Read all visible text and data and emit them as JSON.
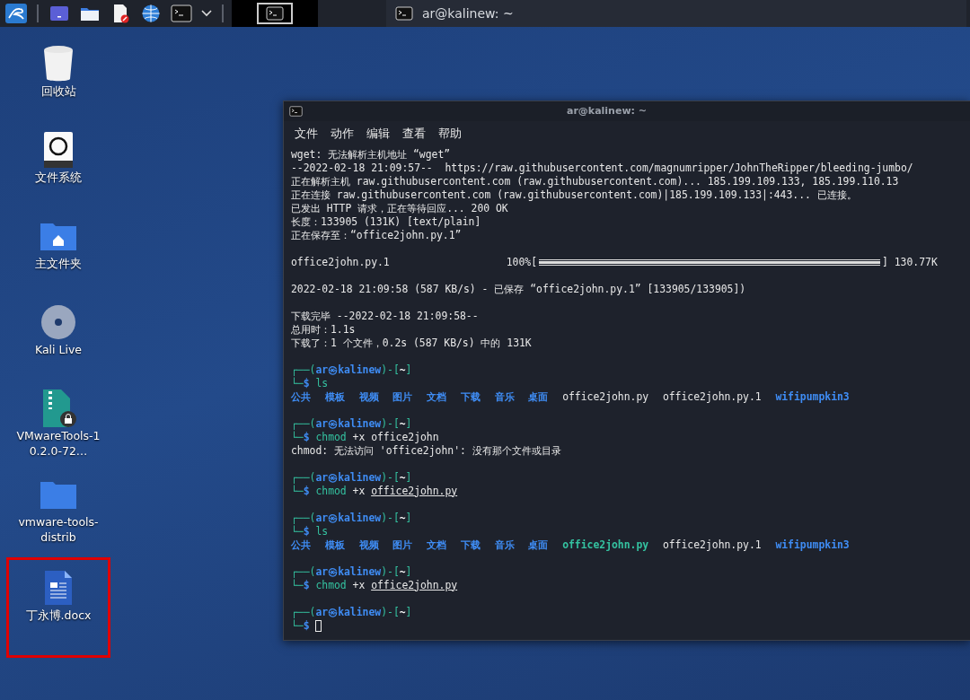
{
  "taskbar": {
    "launchers": [
      {
        "kind": "desktop"
      },
      {
        "kind": "folder"
      },
      {
        "kind": "editor"
      },
      {
        "kind": "browser"
      },
      {
        "kind": "terminal"
      },
      {
        "kind": "caret"
      }
    ],
    "tasks": [
      {
        "title": "ar@kalinew: ~",
        "selected": true
      }
    ]
  },
  "desktop_icons": [
    {
      "kind": "trash",
      "label": "回收站",
      "highlighted": false
    },
    {
      "kind": "drive",
      "label": "文件系统",
      "highlighted": false
    },
    {
      "kind": "home",
      "label": "主文件夹",
      "highlighted": false
    },
    {
      "kind": "disc",
      "label": "Kali Live",
      "highlighted": false
    },
    {
      "kind": "archive",
      "label": "VMwareTools-10.2.0-72…",
      "highlighted": false
    },
    {
      "kind": "folder",
      "label": "vmware-tools-distrib",
      "highlighted": false
    },
    {
      "kind": "document",
      "label": "丁永博.docx",
      "highlighted": true
    }
  ],
  "terminal": {
    "title": "ar@kalinew: ~",
    "menu": [
      "文件",
      "动作",
      "编辑",
      "查看",
      "帮助"
    ],
    "lines": [
      {
        "kind": "text",
        "segments": [
          {
            "kind": "plain",
            "text": "wget: 无法解析主机地址 “wget”"
          }
        ]
      },
      {
        "kind": "text",
        "segments": [
          {
            "kind": "plain",
            "text": "--2022-02-18 21:09:57--  https://raw.githubusercontent.com/magnumripper/JohnTheRipper/bleeding-jumbo/"
          }
        ]
      },
      {
        "kind": "text",
        "segments": [
          {
            "kind": "plain",
            "text": "正在解析主机 raw.githubusercontent.com (raw.githubusercontent.com)... 185.199.109.133, 185.199.110.13"
          }
        ]
      },
      {
        "kind": "text",
        "segments": [
          {
            "kind": "plain",
            "text": "正在连接 raw.githubusercontent.com (raw.githubusercontent.com)|185.199.109.133|:443... 已连接。"
          }
        ]
      },
      {
        "kind": "text",
        "segments": [
          {
            "kind": "plain",
            "text": "已发出 HTTP 请求，正在等待回应... 200 OK"
          }
        ]
      },
      {
        "kind": "text",
        "segments": [
          {
            "kind": "plain",
            "text": "长度：133905 (131K) [text/plain]"
          }
        ]
      },
      {
        "kind": "text",
        "segments": [
          {
            "kind": "plain",
            "text": "正在保存至：“office2john.py.1”"
          }
        ]
      },
      {
        "kind": "blank"
      },
      {
        "kind": "progress",
        "file": "office2john.py.1",
        "percent": "100%[",
        "level": 1,
        "end": "] 130.77K"
      },
      {
        "kind": "blank"
      },
      {
        "kind": "text",
        "segments": [
          {
            "kind": "plain",
            "text": "2022-02-18 21:09:58 (587 KB/s) - 已保存 “office2john.py.1” [133905/133905])"
          }
        ]
      },
      {
        "kind": "blank"
      },
      {
        "kind": "text",
        "segments": [
          {
            "kind": "plain",
            "text": "下载完毕 --2022-02-18 21:09:58--"
          }
        ]
      },
      {
        "kind": "text",
        "segments": [
          {
            "kind": "plain",
            "text": "总用时：1.1s"
          }
        ]
      },
      {
        "kind": "text",
        "segments": [
          {
            "kind": "plain",
            "text": "下载了：1 个文件，0.2s (587 KB/s) 中的 131K"
          }
        ]
      },
      {
        "kind": "blank"
      },
      {
        "kind": "prompt",
        "segments": [
          {
            "kind": "frame",
            "text": "┌──("
          },
          {
            "kind": "user",
            "text": "ar㉿kalinew"
          },
          {
            "kind": "frame",
            "text": ")-["
          },
          {
            "kind": "cwd",
            "text": "~"
          },
          {
            "kind": "frame",
            "text": "]"
          }
        ]
      },
      {
        "kind": "command",
        "segments": [
          {
            "kind": "frame",
            "text": "└─"
          },
          {
            "kind": "dollar",
            "text": "$"
          },
          {
            "kind": "cmd",
            "text": "ls"
          }
        ]
      },
      {
        "kind": "listing",
        "segments": [
          {
            "kind": "dir",
            "text": "公共"
          },
          {
            "kind": "dir",
            "text": "模板"
          },
          {
            "kind": "dir",
            "text": "视频"
          },
          {
            "kind": "dir",
            "text": "图片"
          },
          {
            "kind": "dir",
            "text": "文档"
          },
          {
            "kind": "dir",
            "text": "下载"
          },
          {
            "kind": "dir",
            "text": "音乐"
          },
          {
            "kind": "dir",
            "text": "桌面"
          },
          {
            "kind": "file",
            "text": "office2john.py"
          },
          {
            "kind": "file",
            "text": "office2john.py.1"
          },
          {
            "kind": "dir",
            "text": "wifipumpkin3"
          }
        ]
      },
      {
        "kind": "blank"
      },
      {
        "kind": "prompt",
        "segments": [
          {
            "kind": "frame",
            "text": "┌──("
          },
          {
            "kind": "user",
            "text": "ar㉿kalinew"
          },
          {
            "kind": "frame",
            "text": ")-["
          },
          {
            "kind": "cwd",
            "text": "~"
          },
          {
            "kind": "frame",
            "text": "]"
          }
        ]
      },
      {
        "kind": "command",
        "segments": [
          {
            "kind": "frame",
            "text": "└─"
          },
          {
            "kind": "dollar",
            "text": "$"
          },
          {
            "kind": "cmd",
            "text": "chmod"
          },
          {
            "kind": "arg",
            "text": "+x"
          },
          {
            "kind": "arg",
            "text": "office2john"
          }
        ]
      },
      {
        "kind": "text",
        "segments": [
          {
            "kind": "plain",
            "text": "chmod: 无法访问 'office2john': 没有那个文件或目录"
          }
        ]
      },
      {
        "kind": "blank"
      },
      {
        "kind": "prompt",
        "segments": [
          {
            "kind": "frame",
            "text": "┌──("
          },
          {
            "kind": "user",
            "text": "ar㉿kalinew"
          },
          {
            "kind": "frame",
            "text": ")-["
          },
          {
            "kind": "cwd",
            "text": "~"
          },
          {
            "kind": "frame",
            "text": "]"
          }
        ]
      },
      {
        "kind": "command",
        "segments": [
          {
            "kind": "frame",
            "text": "└─"
          },
          {
            "kind": "dollar",
            "text": "$"
          },
          {
            "kind": "cmd",
            "text": "chmod"
          },
          {
            "kind": "arg",
            "text": "+x"
          },
          {
            "kind": "path",
            "text": "office2john.py"
          }
        ]
      },
      {
        "kind": "blank"
      },
      {
        "kind": "prompt",
        "segments": [
          {
            "kind": "frame",
            "text": "┌──("
          },
          {
            "kind": "user",
            "text": "ar㉿kalinew"
          },
          {
            "kind": "frame",
            "text": ")-["
          },
          {
            "kind": "cwd",
            "text": "~"
          },
          {
            "kind": "frame",
            "text": "]"
          }
        ]
      },
      {
        "kind": "command",
        "segments": [
          {
            "kind": "frame",
            "text": "└─"
          },
          {
            "kind": "dollar",
            "text": "$"
          },
          {
            "kind": "cmd",
            "text": "ls"
          }
        ]
      },
      {
        "kind": "listing",
        "segments": [
          {
            "kind": "dir",
            "text": "公共"
          },
          {
            "kind": "dir",
            "text": "模板"
          },
          {
            "kind": "dir",
            "text": "视频"
          },
          {
            "kind": "dir",
            "text": "图片"
          },
          {
            "kind": "dir",
            "text": "文档"
          },
          {
            "kind": "dir",
            "text": "下载"
          },
          {
            "kind": "dir",
            "text": "音乐"
          },
          {
            "kind": "dir",
            "text": "桌面"
          },
          {
            "kind": "exec",
            "text": "office2john.py"
          },
          {
            "kind": "file",
            "text": "office2john.py.1"
          },
          {
            "kind": "dir",
            "text": "wifipumpkin3"
          }
        ]
      },
      {
        "kind": "blank"
      },
      {
        "kind": "prompt",
        "segments": [
          {
            "kind": "frame",
            "text": "┌──("
          },
          {
            "kind": "user",
            "text": "ar㉿kalinew"
          },
          {
            "kind": "frame",
            "text": ")-["
          },
          {
            "kind": "cwd",
            "text": "~"
          },
          {
            "kind": "frame",
            "text": "]"
          }
        ]
      },
      {
        "kind": "command",
        "segments": [
          {
            "kind": "frame",
            "text": "└─"
          },
          {
            "kind": "dollar",
            "text": "$"
          },
          {
            "kind": "cmd",
            "text": "chmod"
          },
          {
            "kind": "arg",
            "text": "+x"
          },
          {
            "kind": "path",
            "text": "office2john.py"
          }
        ]
      },
      {
        "kind": "blank"
      },
      {
        "kind": "prompt",
        "segments": [
          {
            "kind": "frame",
            "text": "┌──("
          },
          {
            "kind": "user",
            "text": "ar㉿kalinew"
          },
          {
            "kind": "frame",
            "text": ")-["
          },
          {
            "kind": "cwd",
            "text": "~"
          },
          {
            "kind": "frame",
            "text": "]"
          }
        ]
      },
      {
        "kind": "command",
        "segments": [
          {
            "kind": "frame",
            "text": "└─"
          },
          {
            "kind": "dollar",
            "text": "$"
          },
          {
            "kind": "cursor"
          }
        ]
      }
    ]
  }
}
